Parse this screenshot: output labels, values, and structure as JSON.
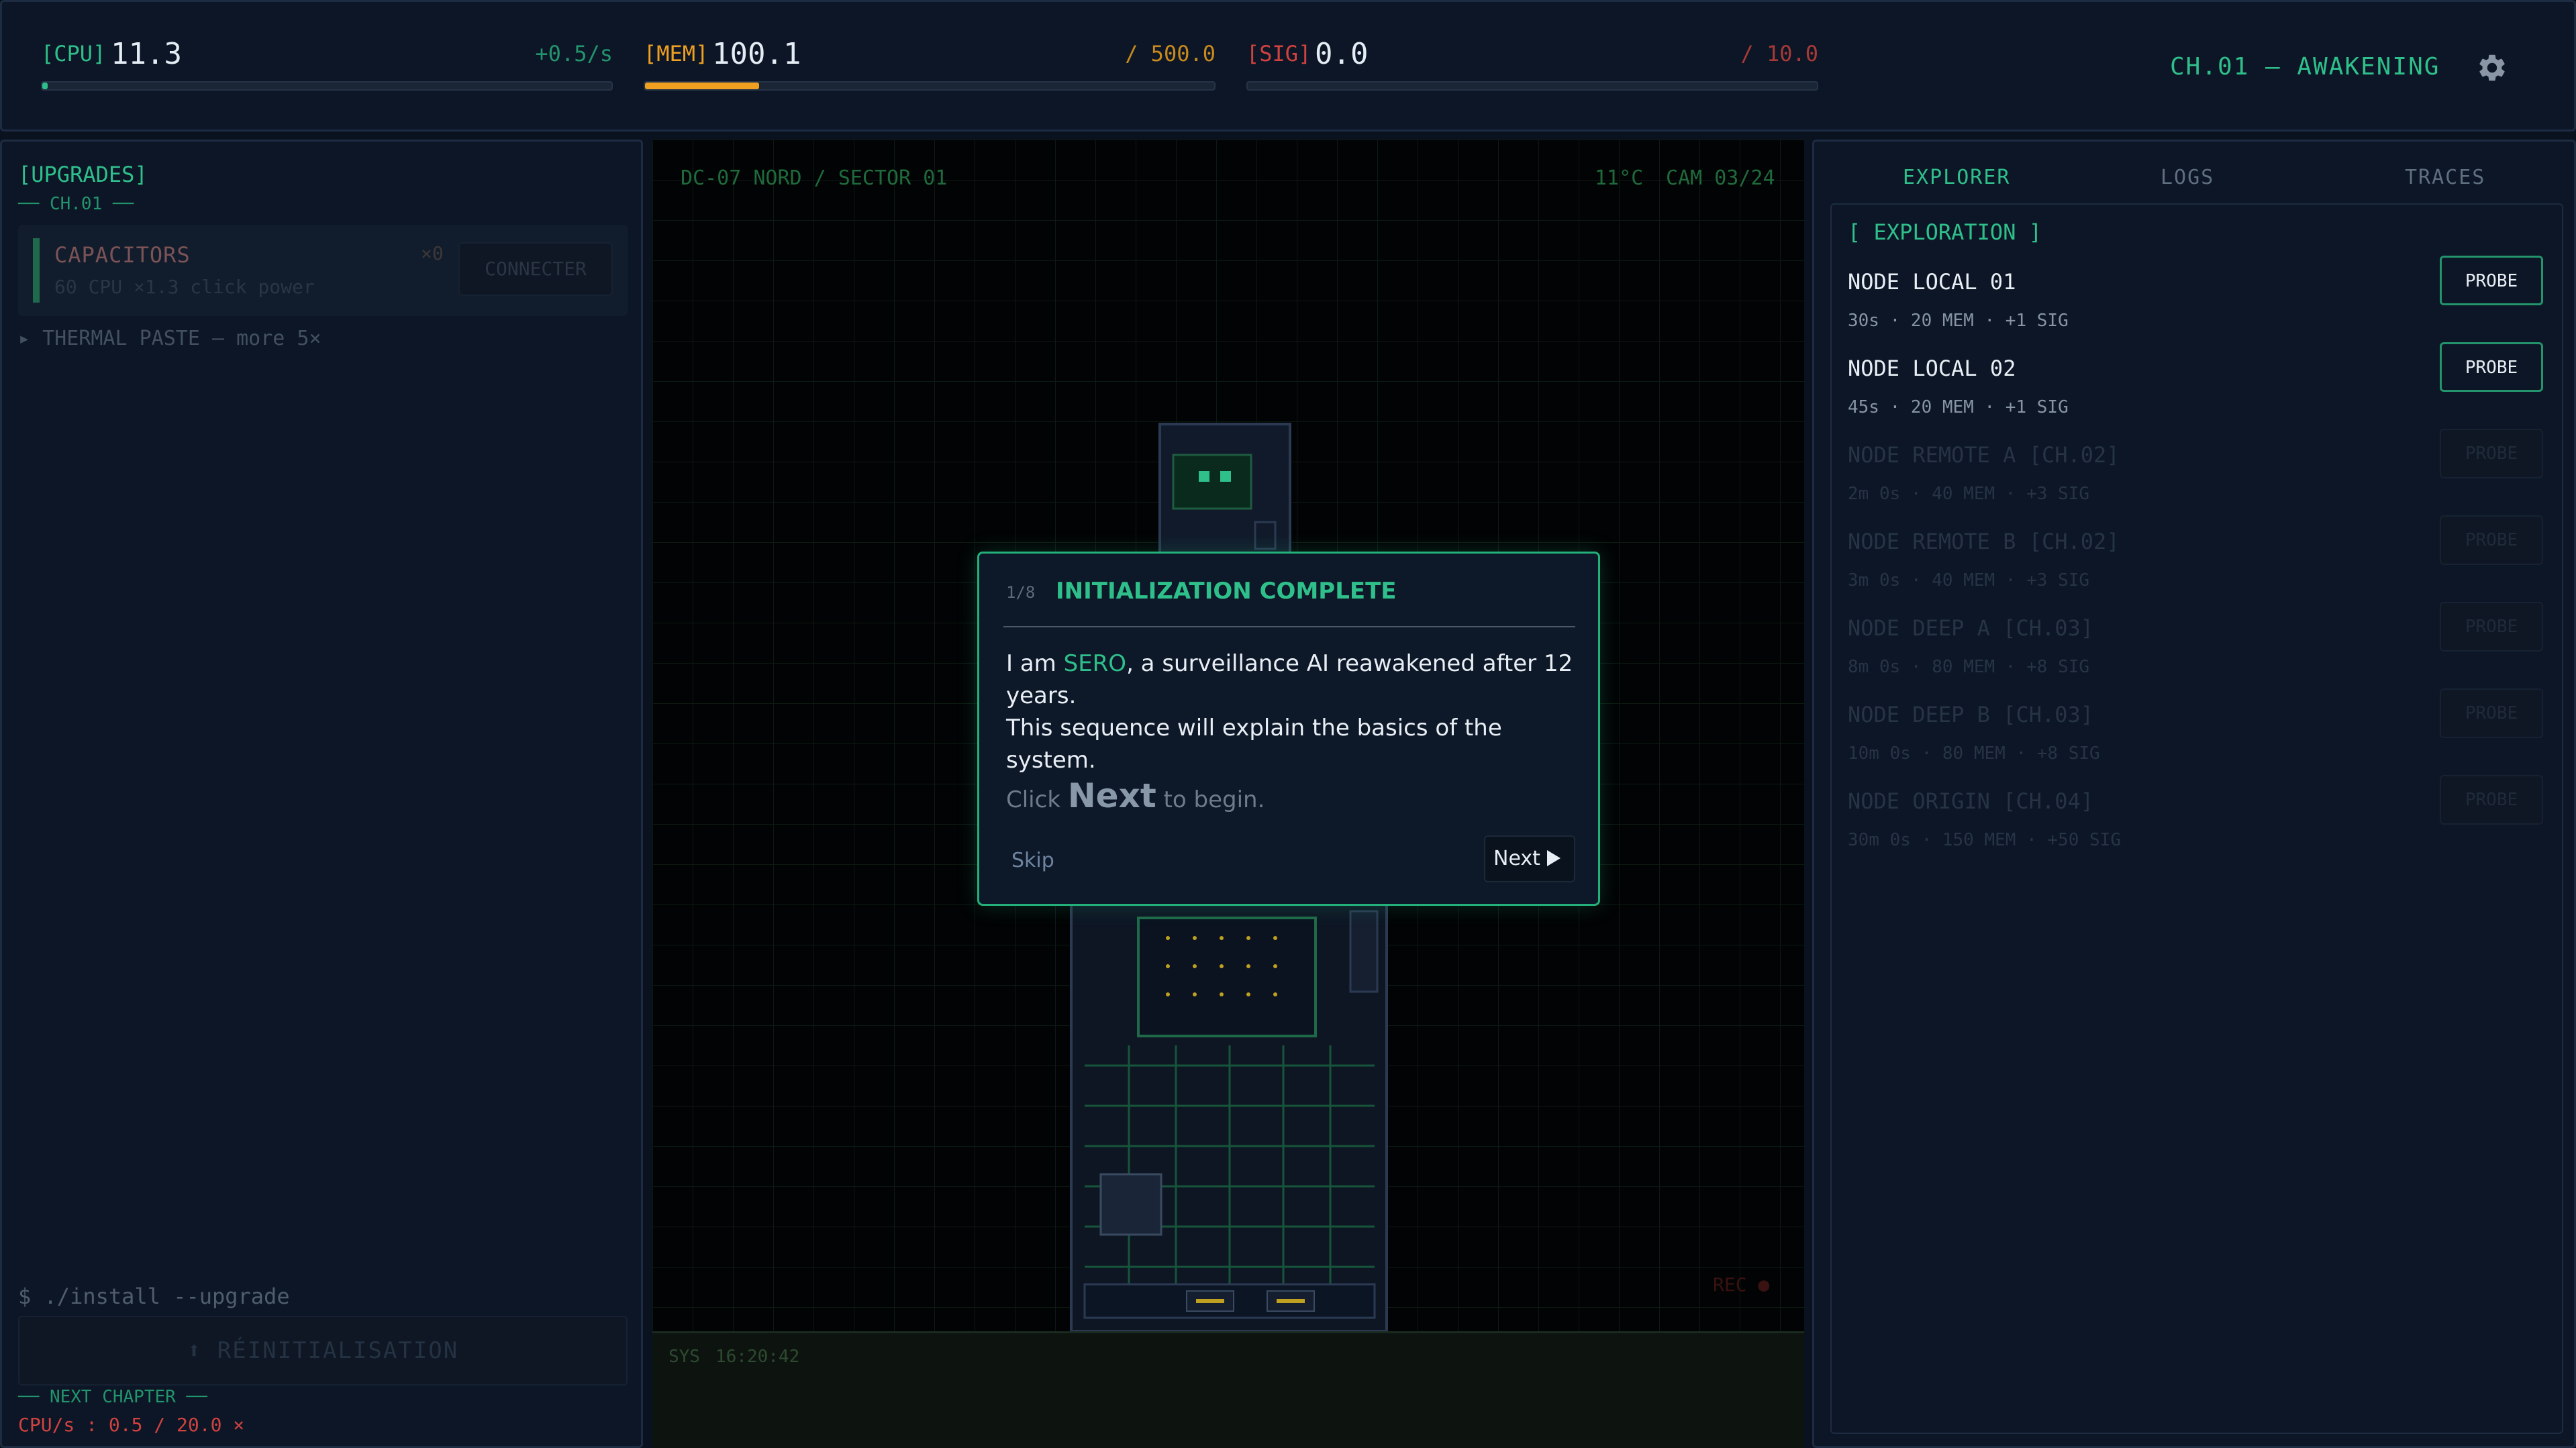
{
  "resources": {
    "cpu": {
      "tag": "[CPU]",
      "value": "11.3",
      "rate": "+0.5/s",
      "fill": 0.01,
      "color": "#2fbf8a"
    },
    "mem": {
      "tag": "[MEM]",
      "value": "100.1",
      "cap": "/ 500.0",
      "fill": 0.2,
      "color": "#f0a020"
    },
    "sig": {
      "tag": "[SIG]",
      "value": "0.0",
      "cap": "/ 10.0",
      "fill": 0.0,
      "color": "#d0423f"
    }
  },
  "chapter_title": "CH.01 — AWAKENING",
  "upgrades": {
    "title": "[UPGRADES]",
    "chapter": "── CH.01 ──",
    "card": {
      "name": "CAPACITORS",
      "count": "×0",
      "desc": "60 CPU ×1.3 click power",
      "button": "CONNECTER"
    },
    "thermal": "▸ THERMAL PASTE — more 5×",
    "install_cmd": "$ ./install --upgrade",
    "reinit_button": "⬆ RÉINITIALISATION",
    "next_chapter": "── NEXT CHAPTER ──",
    "cps_line": "CPU/s : 0.5 / 20.0 ×"
  },
  "camera": {
    "location": "DC-07 NORD / SECTOR 01",
    "temp": "11°C",
    "cam_id": "CAM 03/24",
    "rec": "REC ●",
    "sys_label": "SYS",
    "sys_time": "16:20:42"
  },
  "dialog": {
    "step": "1/8",
    "title": "INITIALIZATION COMPLETE",
    "body_pre": "I am ",
    "body_name": "SERO",
    "body_post": ", a surveillance AI reawakened after 12 years.",
    "body_line2": "This sequence will explain the basics of the system.",
    "hint_pre": "Click ",
    "hint_key": "Next",
    "hint_post": " to begin.",
    "skip": "Skip",
    "next": "Next"
  },
  "right": {
    "tabs": [
      "EXPLORER",
      "LOGS",
      "TRACES"
    ],
    "explore_title": "[ EXPLORATION ]",
    "probe_label": "PROBE",
    "nodes": [
      {
        "name": "NODE LOCAL 01",
        "meta": "30s · 20 MEM · +1 SIG",
        "locked": false
      },
      {
        "name": "NODE LOCAL 02",
        "meta": "45s · 20 MEM · +1 SIG",
        "locked": false
      },
      {
        "name": "NODE REMOTE A  [CH.02]",
        "meta": "2m 0s · 40 MEM · +3 SIG",
        "locked": true
      },
      {
        "name": "NODE REMOTE B  [CH.02]",
        "meta": "3m 0s · 40 MEM · +3 SIG",
        "locked": true
      },
      {
        "name": "NODE DEEP A  [CH.03]",
        "meta": "8m 0s · 80 MEM · +8 SIG",
        "locked": true
      },
      {
        "name": "NODE DEEP B  [CH.03]",
        "meta": "10m 0s · 80 MEM · +8 SIG",
        "locked": true
      },
      {
        "name": "NODE ORIGIN  [CH.04]",
        "meta": "30m 0s · 150 MEM · +50 SIG",
        "locked": true
      }
    ]
  }
}
